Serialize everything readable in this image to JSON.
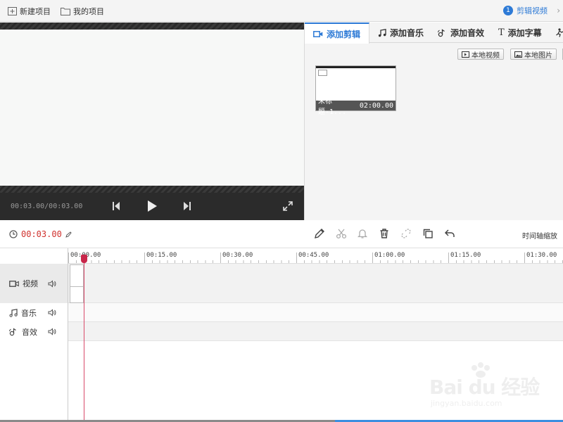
{
  "topbar": {
    "new_project": "新建项目",
    "my_projects": "我的项目",
    "step_number": "1",
    "step_label": "剪辑视频"
  },
  "player": {
    "timecode": "00:03.00/00:03.00"
  },
  "tabs": [
    {
      "label": "添加剪辑",
      "active": true
    },
    {
      "label": "添加音乐",
      "active": false
    },
    {
      "label": "添加音效",
      "active": false
    },
    {
      "label": "添加字幕",
      "active": false
    }
  ],
  "import": {
    "local_video": "本地视频",
    "local_image": "本地图片"
  },
  "clip": {
    "name": "未标题-1...",
    "duration": "02:00.00"
  },
  "editor": {
    "current_time": "00:03.00",
    "zoom_label": "时间轴缩放"
  },
  "ruler": {
    "ticks": [
      "00:00.00",
      "00:15.00",
      "00:30.00",
      "00:45.00",
      "01:00.00",
      "01:15.00",
      "01:30.00"
    ]
  },
  "tracks": {
    "video": "视频",
    "music": "音乐",
    "sfx": "音效"
  },
  "watermark": {
    "brand": "Bai du 经验",
    "url": "jingyan.baidu.com"
  },
  "colors": {
    "accent": "#2d7ad6",
    "timecode_red": "#d0312d",
    "playhead": "#c8264a"
  }
}
